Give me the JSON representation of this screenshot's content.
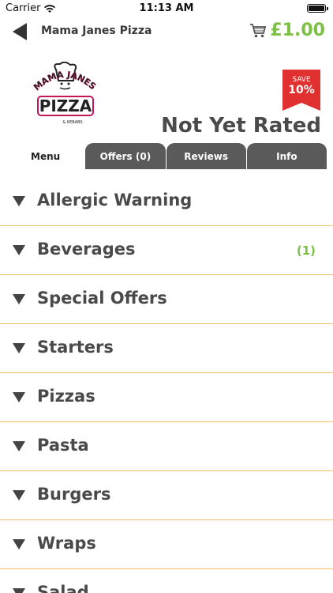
{
  "status_bar": {
    "carrier": "Carrier",
    "time": "11:13 AM"
  },
  "nav": {
    "title": "Mama Janes Pizza",
    "cart_total": "£1.00",
    "icons": [
      "back-arrow-icon",
      "shopping-cart-icon"
    ]
  },
  "header": {
    "logo_alt": "MAMA JANES PIZZA & KEBABS",
    "save_badge": {
      "label": "SAVE",
      "value": "10%"
    },
    "rating_text": "Not Yet Rated"
  },
  "tabs": [
    {
      "label": "Menu",
      "active": true
    },
    {
      "label": "Offers (0)",
      "active": false
    },
    {
      "label": "Reviews",
      "active": false
    },
    {
      "label": "Info",
      "active": false
    }
  ],
  "menu_categories": [
    {
      "label": "Allergic Warning",
      "count": ""
    },
    {
      "label": "Beverages",
      "count": "(1)"
    },
    {
      "label": "Special Offers",
      "count": ""
    },
    {
      "label": "Starters",
      "count": ""
    },
    {
      "label": "Pizzas",
      "count": ""
    },
    {
      "label": "Pasta",
      "count": ""
    },
    {
      "label": "Burgers",
      "count": ""
    },
    {
      "label": "Wraps",
      "count": ""
    },
    {
      "label": "Salad",
      "count": ""
    }
  ],
  "colors": {
    "accent_green": "#7bc043",
    "divider": "#f0c060",
    "tab_inactive": "#5a5a5a",
    "badge_red": "#e03030"
  }
}
